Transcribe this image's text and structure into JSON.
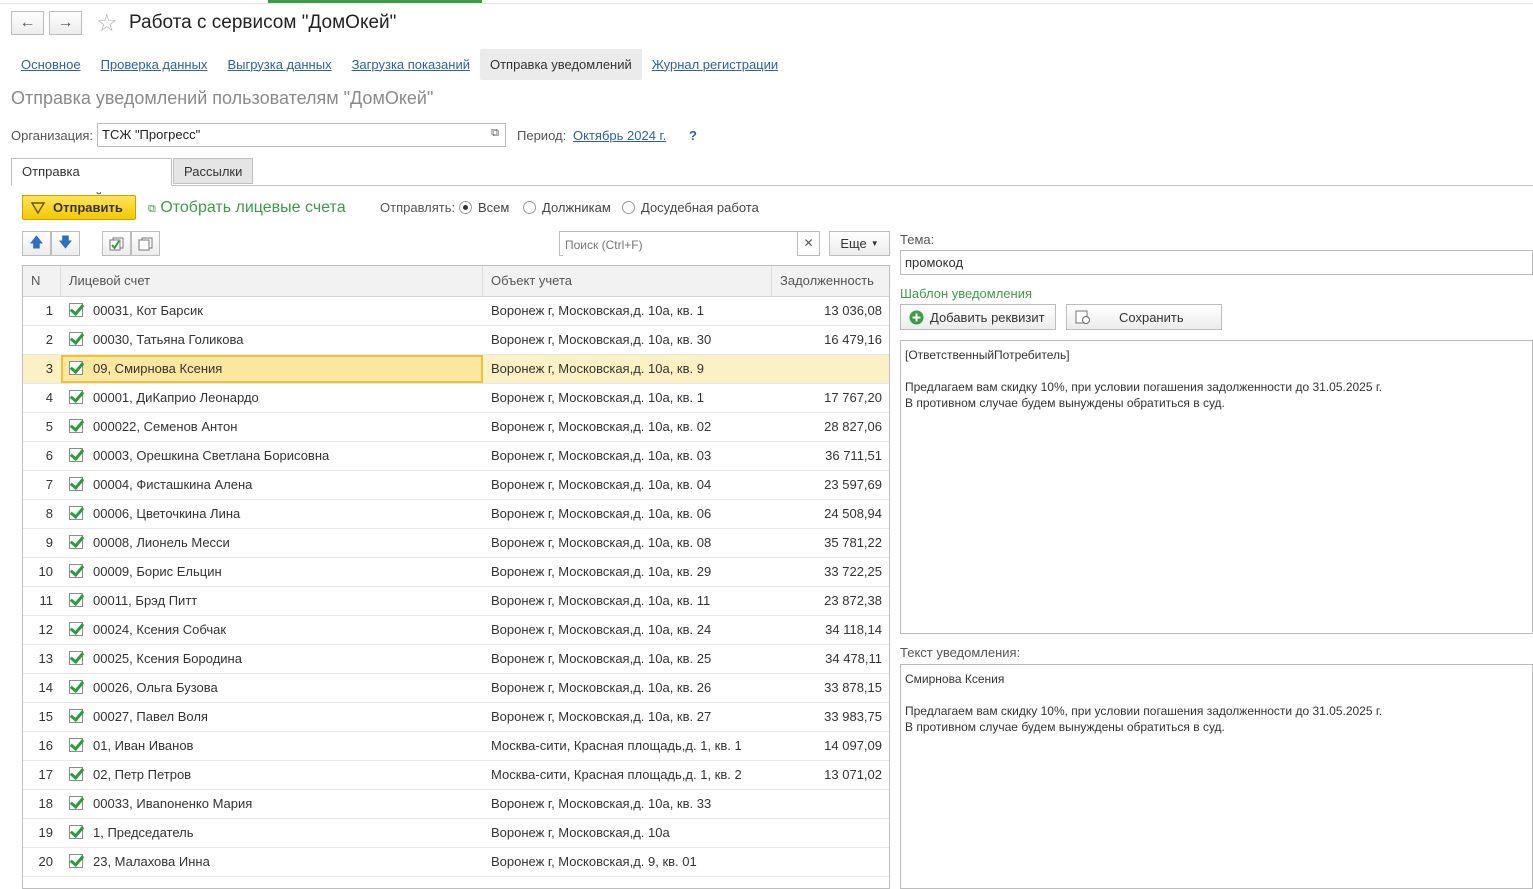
{
  "window": {
    "title": "Работа с сервисом \"ДомОкей\"",
    "back_icon": "←",
    "forward_icon": "→",
    "star_icon": "☆"
  },
  "links": [
    "Основное",
    "Проверка данных",
    "Выгрузка данных",
    "Загрузка показаний",
    "Отправка уведомлений",
    "Журнал регистрации"
  ],
  "page": {
    "subtitle": "Отправка уведомлений пользователям \"ДомОкей\"",
    "org_label": "Организация:",
    "org_value": "ТСЖ \"Прогресс\"",
    "period_label": "Период:",
    "period_value": "Октябрь 2024 г.",
    "help": "?"
  },
  "tabs": [
    "Отправка уведомлений",
    "Рассылки"
  ],
  "toolbar": {
    "send_label": "Отправить",
    "filter_label": "Отобрать лицевые счета",
    "send_to_label": "Отправлять:",
    "radios": [
      "Всем",
      "Должникам",
      "Досудебная работа"
    ],
    "selected_radio": "Всем",
    "search_placeholder": "Поиск (Ctrl+F)",
    "more_label": "Еще",
    "clear_icon": "✕"
  },
  "table": {
    "columns": [
      "N",
      "Лицевой счет",
      "Объект учета",
      "Задолженность"
    ],
    "rows": [
      {
        "n": "1",
        "account": "00031, Кот Барсик",
        "object": "Воронеж г, Московская,д. 10а, кв. 1",
        "debt": "13 036,08"
      },
      {
        "n": "2",
        "account": "00030, Татьяна Голикова",
        "object": "Воронеж г, Московская,д. 10а, кв. 30",
        "debt": "16 479,16"
      },
      {
        "n": "3",
        "account": "09, Смирнова Ксения",
        "object": "Воронеж г, Московская,д. 10а, кв. 9",
        "debt": ""
      },
      {
        "n": "4",
        "account": "00001, ДиКаприо Леонардо",
        "object": "Воронеж г, Московская,д. 10а, кв. 1",
        "debt": "17 767,20"
      },
      {
        "n": "5",
        "account": "000022, Семенов Антон",
        "object": "Воронеж г, Московская,д. 10а, кв. 02",
        "debt": "28 827,06"
      },
      {
        "n": "6",
        "account": "00003, Орешкина Светлана Борисовна",
        "object": "Воронеж г, Московская,д. 10а, кв. 03",
        "debt": "36 711,51"
      },
      {
        "n": "7",
        "account": "00004, Фисташкина Алена",
        "object": "Воронеж г, Московская,д. 10а, кв. 04",
        "debt": "23 597,69"
      },
      {
        "n": "8",
        "account": "00006, Цветочкина Лина",
        "object": "Воронеж г, Московская,д. 10а, кв. 06",
        "debt": "24 508,94"
      },
      {
        "n": "9",
        "account": "00008, Лионель Месси",
        "object": "Воронеж г, Московская,д. 10а, кв. 08",
        "debt": "35 781,22"
      },
      {
        "n": "10",
        "account": "00009, Борис Ельцин",
        "object": "Воронеж г, Московская,д. 10а, кв. 29",
        "debt": "33 722,25"
      },
      {
        "n": "11",
        "account": "00011, Брэд Питт",
        "object": "Воронеж г, Московская,д. 10а, кв. 11",
        "debt": "23 872,38"
      },
      {
        "n": "12",
        "account": "00024, Ксения Собчак",
        "object": "Воронеж г, Московская,д. 10а, кв. 24",
        "debt": "34 118,14"
      },
      {
        "n": "13",
        "account": "00025, Ксения Бородина",
        "object": "Воронеж г, Московская,д. 10а, кв. 25",
        "debt": "34 478,11"
      },
      {
        "n": "14",
        "account": "00026, Ольга Бузова",
        "object": "Воронеж г, Московская,д. 10а, кв. 26",
        "debt": "33 878,15"
      },
      {
        "n": "15",
        "account": "00027, Павел Воля",
        "object": "Воронеж г, Московская,д. 10а, кв. 27",
        "debt": "33 983,75"
      },
      {
        "n": "16",
        "account": "01, Иван Иванов",
        "object": "Москва-сити, Красная площадь,д. 1, кв. 1",
        "debt": "14 097,09"
      },
      {
        "n": "17",
        "account": "02, Петр Петров",
        "object": "Москва-сити, Красная площадь,д. 1, кв. 2",
        "debt": "13 071,02"
      },
      {
        "n": "18",
        "account": "00033, Ивanoненко Мария",
        "object": "Воронеж г, Московская,д. 10а, кв. 33",
        "debt": ""
      },
      {
        "n": "19",
        "account": "1, Председатель",
        "object": "Воронеж г, Московская,д. 10а",
        "debt": ""
      },
      {
        "n": "20",
        "account": "23, Малахова Инна",
        "object": "Воронеж г, Московская,д. 9, кв. 01",
        "debt": ""
      }
    ],
    "selected_row": 3
  },
  "right": {
    "topic_label": "Тема:",
    "topic_value": "промокод",
    "template_label": "Шаблон уведомления",
    "add_prop_label": "Добавить реквизит",
    "save_label": "Сохранить",
    "template_text": "[ОтветственныйПотребитель]\n\nПредлагаем вам скидку 10%, при условии погашения задолженности до 31.05.2025 г.\nВ противном случае будем вынуждены обратиться в суд.",
    "text_label": "Текст уведомления:",
    "notification_text": "Смирнова Ксения\n\nПредлагаем вам скидку 10%, при условии погашения задолженности до 31.05.2025 г.\nВ противном случае будем вынуждены обратиться в суд."
  },
  "colors": {
    "accent_green": "#3d9b47",
    "link_blue": "#2d5fa8",
    "send_yellow": "#f5c800",
    "selection": "#fbf1c4"
  }
}
